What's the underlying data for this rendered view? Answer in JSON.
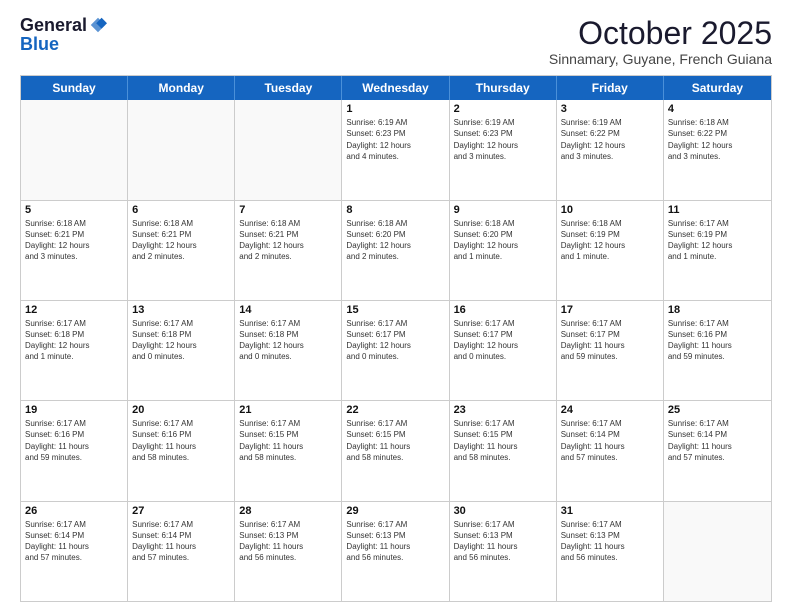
{
  "header": {
    "logo_general": "General",
    "logo_blue": "Blue",
    "month_title": "October 2025",
    "location": "Sinnamary, Guyane, French Guiana"
  },
  "weekdays": [
    "Sunday",
    "Monday",
    "Tuesday",
    "Wednesday",
    "Thursday",
    "Friday",
    "Saturday"
  ],
  "rows": [
    [
      {
        "day": "",
        "info": ""
      },
      {
        "day": "",
        "info": ""
      },
      {
        "day": "",
        "info": ""
      },
      {
        "day": "1",
        "info": "Sunrise: 6:19 AM\nSunset: 6:23 PM\nDaylight: 12 hours\nand 4 minutes."
      },
      {
        "day": "2",
        "info": "Sunrise: 6:19 AM\nSunset: 6:23 PM\nDaylight: 12 hours\nand 3 minutes."
      },
      {
        "day": "3",
        "info": "Sunrise: 6:19 AM\nSunset: 6:22 PM\nDaylight: 12 hours\nand 3 minutes."
      },
      {
        "day": "4",
        "info": "Sunrise: 6:18 AM\nSunset: 6:22 PM\nDaylight: 12 hours\nand 3 minutes."
      }
    ],
    [
      {
        "day": "5",
        "info": "Sunrise: 6:18 AM\nSunset: 6:21 PM\nDaylight: 12 hours\nand 3 minutes."
      },
      {
        "day": "6",
        "info": "Sunrise: 6:18 AM\nSunset: 6:21 PM\nDaylight: 12 hours\nand 2 minutes."
      },
      {
        "day": "7",
        "info": "Sunrise: 6:18 AM\nSunset: 6:21 PM\nDaylight: 12 hours\nand 2 minutes."
      },
      {
        "day": "8",
        "info": "Sunrise: 6:18 AM\nSunset: 6:20 PM\nDaylight: 12 hours\nand 2 minutes."
      },
      {
        "day": "9",
        "info": "Sunrise: 6:18 AM\nSunset: 6:20 PM\nDaylight: 12 hours\nand 1 minute."
      },
      {
        "day": "10",
        "info": "Sunrise: 6:18 AM\nSunset: 6:19 PM\nDaylight: 12 hours\nand 1 minute."
      },
      {
        "day": "11",
        "info": "Sunrise: 6:17 AM\nSunset: 6:19 PM\nDaylight: 12 hours\nand 1 minute."
      }
    ],
    [
      {
        "day": "12",
        "info": "Sunrise: 6:17 AM\nSunset: 6:18 PM\nDaylight: 12 hours\nand 1 minute."
      },
      {
        "day": "13",
        "info": "Sunrise: 6:17 AM\nSunset: 6:18 PM\nDaylight: 12 hours\nand 0 minutes."
      },
      {
        "day": "14",
        "info": "Sunrise: 6:17 AM\nSunset: 6:18 PM\nDaylight: 12 hours\nand 0 minutes."
      },
      {
        "day": "15",
        "info": "Sunrise: 6:17 AM\nSunset: 6:17 PM\nDaylight: 12 hours\nand 0 minutes."
      },
      {
        "day": "16",
        "info": "Sunrise: 6:17 AM\nSunset: 6:17 PM\nDaylight: 12 hours\nand 0 minutes."
      },
      {
        "day": "17",
        "info": "Sunrise: 6:17 AM\nSunset: 6:17 PM\nDaylight: 11 hours\nand 59 minutes."
      },
      {
        "day": "18",
        "info": "Sunrise: 6:17 AM\nSunset: 6:16 PM\nDaylight: 11 hours\nand 59 minutes."
      }
    ],
    [
      {
        "day": "19",
        "info": "Sunrise: 6:17 AM\nSunset: 6:16 PM\nDaylight: 11 hours\nand 59 minutes."
      },
      {
        "day": "20",
        "info": "Sunrise: 6:17 AM\nSunset: 6:16 PM\nDaylight: 11 hours\nand 58 minutes."
      },
      {
        "day": "21",
        "info": "Sunrise: 6:17 AM\nSunset: 6:15 PM\nDaylight: 11 hours\nand 58 minutes."
      },
      {
        "day": "22",
        "info": "Sunrise: 6:17 AM\nSunset: 6:15 PM\nDaylight: 11 hours\nand 58 minutes."
      },
      {
        "day": "23",
        "info": "Sunrise: 6:17 AM\nSunset: 6:15 PM\nDaylight: 11 hours\nand 58 minutes."
      },
      {
        "day": "24",
        "info": "Sunrise: 6:17 AM\nSunset: 6:14 PM\nDaylight: 11 hours\nand 57 minutes."
      },
      {
        "day": "25",
        "info": "Sunrise: 6:17 AM\nSunset: 6:14 PM\nDaylight: 11 hours\nand 57 minutes."
      }
    ],
    [
      {
        "day": "26",
        "info": "Sunrise: 6:17 AM\nSunset: 6:14 PM\nDaylight: 11 hours\nand 57 minutes."
      },
      {
        "day": "27",
        "info": "Sunrise: 6:17 AM\nSunset: 6:14 PM\nDaylight: 11 hours\nand 57 minutes."
      },
      {
        "day": "28",
        "info": "Sunrise: 6:17 AM\nSunset: 6:13 PM\nDaylight: 11 hours\nand 56 minutes."
      },
      {
        "day": "29",
        "info": "Sunrise: 6:17 AM\nSunset: 6:13 PM\nDaylight: 11 hours\nand 56 minutes."
      },
      {
        "day": "30",
        "info": "Sunrise: 6:17 AM\nSunset: 6:13 PM\nDaylight: 11 hours\nand 56 minutes."
      },
      {
        "day": "31",
        "info": "Sunrise: 6:17 AM\nSunset: 6:13 PM\nDaylight: 11 hours\nand 56 minutes."
      },
      {
        "day": "",
        "info": ""
      }
    ]
  ]
}
